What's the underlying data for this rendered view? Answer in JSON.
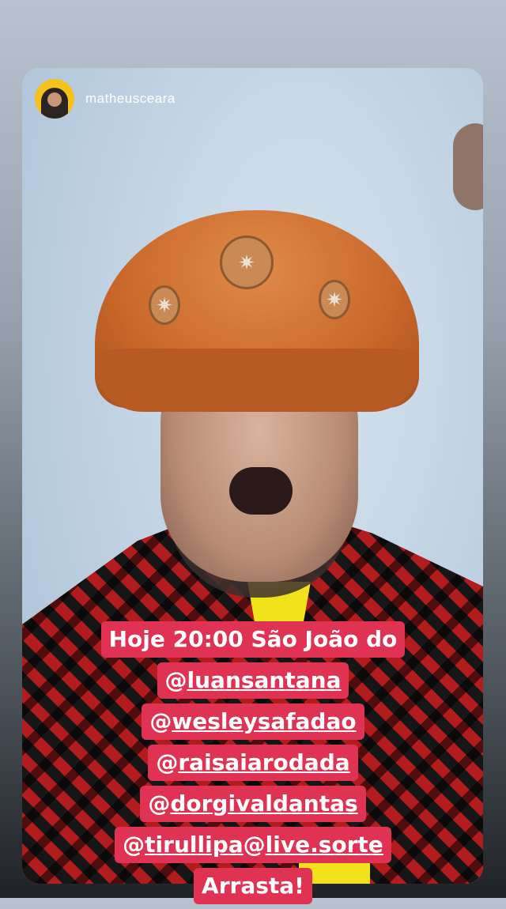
{
  "story": {
    "username": "matheusceara",
    "avatar_icon": "profile-avatar",
    "accent": "#e03252"
  },
  "caption": {
    "line1": "Hoje 20:00 São João do",
    "line2_prefix": "@",
    "line2_mention": "luansantana",
    "line3_prefix": "@",
    "line3_mention": "wesleysafadao",
    "line4_prefix": "@",
    "line4_mention": "raisaiarodada",
    "line5_prefix": "@",
    "line5_mention": "dorgivaldantas",
    "line6a_prefix": "@",
    "line6a_mention": "tirullipa",
    "line6b_prefix": "@",
    "line6b_mention": "live.sorte",
    "line7": "Arrasta!"
  }
}
